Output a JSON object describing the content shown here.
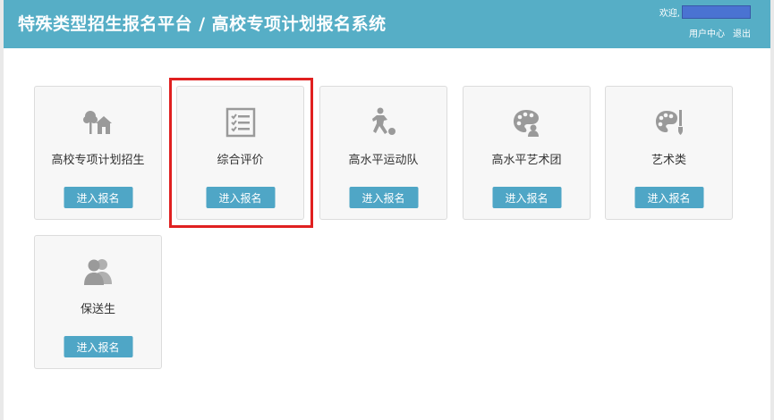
{
  "header": {
    "title": "特殊类型招生报名平台 / 高校专项计划报名系统",
    "welcome_label": "欢迎,",
    "user_center": "用户中心",
    "logout": "退出"
  },
  "cards": [
    {
      "label": "高校专项计划招生",
      "button": "进入报名",
      "icon": "house-tree-icon"
    },
    {
      "label": "综合评价",
      "button": "进入报名",
      "icon": "checklist-icon"
    },
    {
      "label": "高水平运动队",
      "button": "进入报名",
      "icon": "soccer-player-icon"
    },
    {
      "label": "高水平艺术团",
      "button": "进入报名",
      "icon": "palette-person-icon"
    },
    {
      "label": "艺术类",
      "button": "进入报名",
      "icon": "palette-brush-icon"
    },
    {
      "label": "保送生",
      "button": "进入报名",
      "icon": "users-icon"
    }
  ],
  "colors": {
    "header_bg": "#56aec6",
    "button_bg": "#4fa6c6",
    "highlight": "#e02020",
    "user_box": "#4a73d2"
  }
}
